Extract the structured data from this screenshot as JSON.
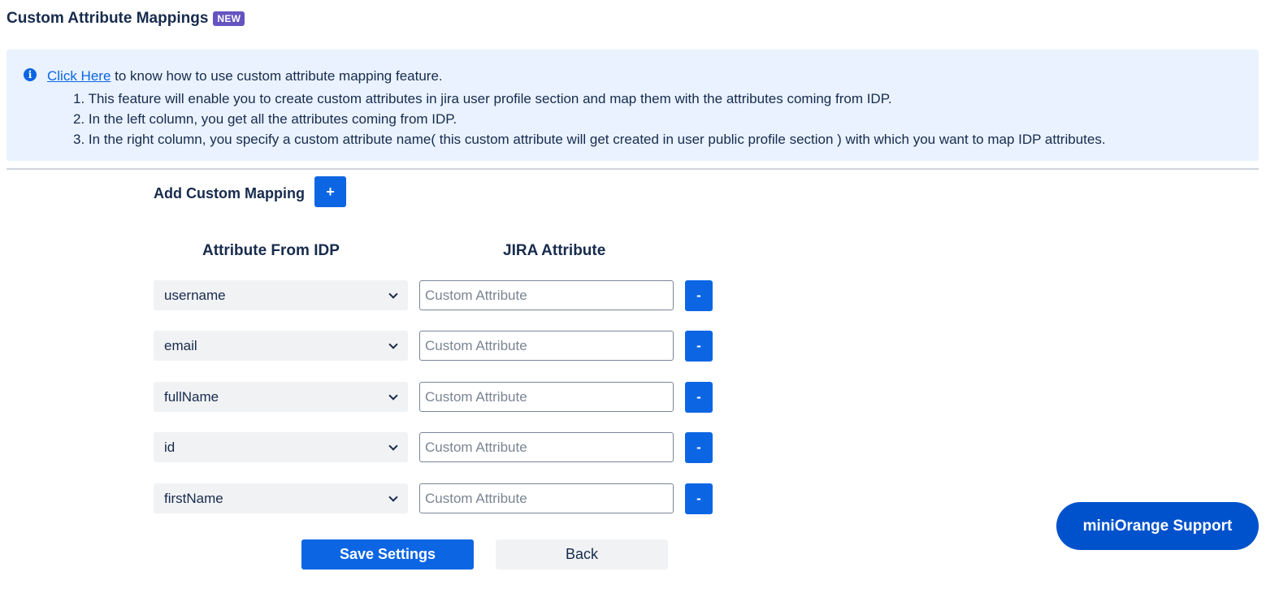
{
  "header": {
    "title": "Custom Attribute Mappings",
    "badge": "NEW"
  },
  "info": {
    "icon": "info-icon",
    "link_text": "Click Here",
    "intro_text": " to know how to use custom attribute mapping feature.",
    "points": [
      "1. This feature will enable you to create custom attributes in jira user profile section and map them with the attributes coming from IDP.",
      "2. In the left column, you get all the attributes coming from IDP.",
      "3. In the right column, you specify a custom attribute name( this custom attribute will get created in user public profile section ) with which you want to map IDP attributes."
    ]
  },
  "mapping": {
    "add_label": "Add Custom Mapping",
    "add_button": "+",
    "col_idp": "Attribute From IDP",
    "col_jira": "JIRA Attribute",
    "rows": [
      {
        "idp_attribute": "username",
        "jira_placeholder": "Custom Attribute",
        "jira_value": "",
        "remove_label": "-"
      },
      {
        "idp_attribute": "email",
        "jira_placeholder": "Custom Attribute",
        "jira_value": "",
        "remove_label": "-"
      },
      {
        "idp_attribute": "fullName",
        "jira_placeholder": "Custom Attribute",
        "jira_value": "",
        "remove_label": "-"
      },
      {
        "idp_attribute": "id",
        "jira_placeholder": "Custom Attribute",
        "jira_value": "",
        "remove_label": "-"
      },
      {
        "idp_attribute": "firstName",
        "jira_placeholder": "Custom Attribute",
        "jira_value": "",
        "remove_label": "-"
      }
    ]
  },
  "actions": {
    "save_label": "Save Settings",
    "back_label": "Back"
  },
  "support": {
    "label": "miniOrange Support"
  },
  "colors": {
    "primary": "#0c66e4",
    "support": "#0052cc",
    "badge": "#6554c0",
    "info_bg": "#e9f2fe",
    "subtle_bg": "#f1f2f4",
    "text": "#172b4d"
  }
}
